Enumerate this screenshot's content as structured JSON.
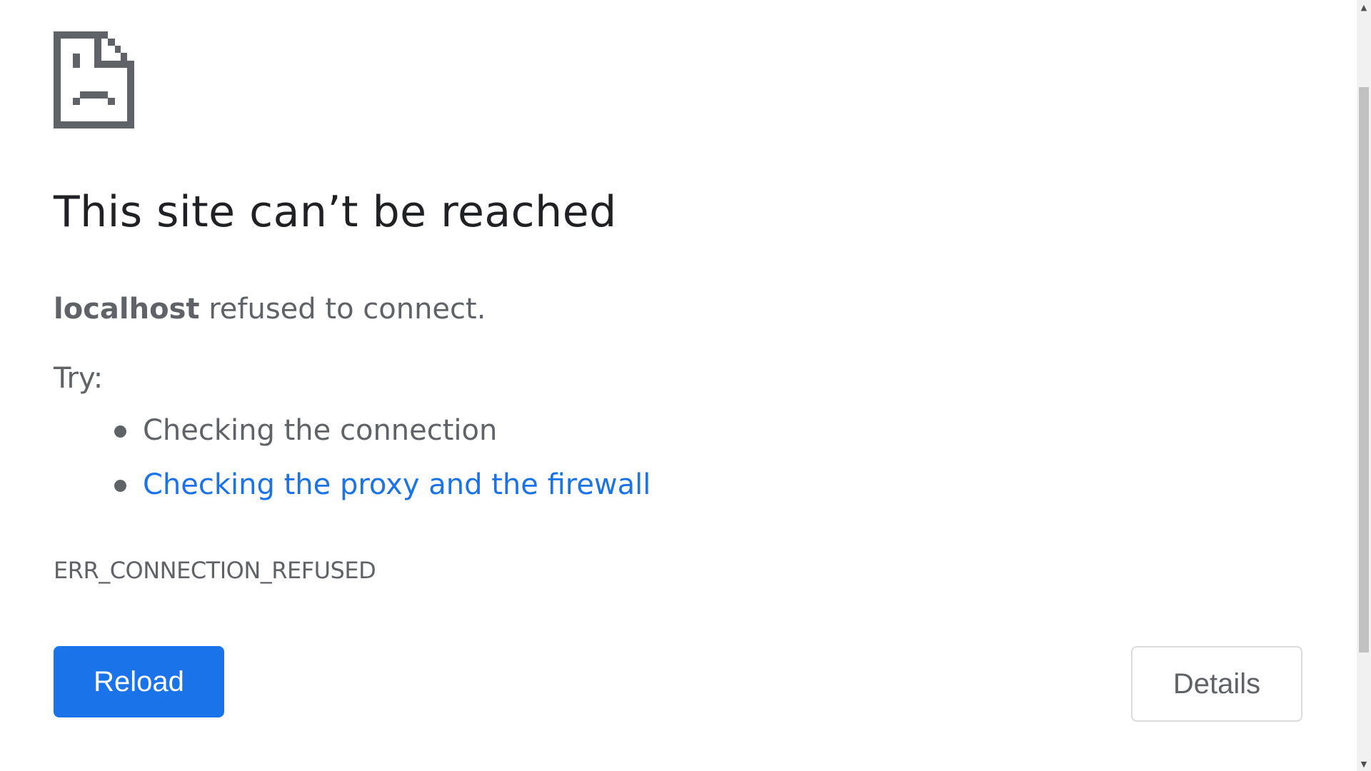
{
  "icon": {
    "name": "sad-page-icon",
    "color": "#5f6368"
  },
  "heading": "This site can’t be reached",
  "message": {
    "host": "localhost",
    "text": " refused to connect."
  },
  "try_label": "Try:",
  "suggestions": [
    {
      "text": "Checking the connection",
      "is_link": false
    },
    {
      "text": "Checking the proxy and the firewall",
      "is_link": true
    }
  ],
  "error_code": "ERR_CONNECTION_REFUSED",
  "buttons": {
    "reload": "Reload",
    "details": "Details"
  },
  "scrollbar": {
    "up_arrow": "▲",
    "down_arrow": "▼"
  },
  "colors": {
    "primary": "#1a73e8",
    "text": "#5f6368",
    "heading": "#202124"
  }
}
